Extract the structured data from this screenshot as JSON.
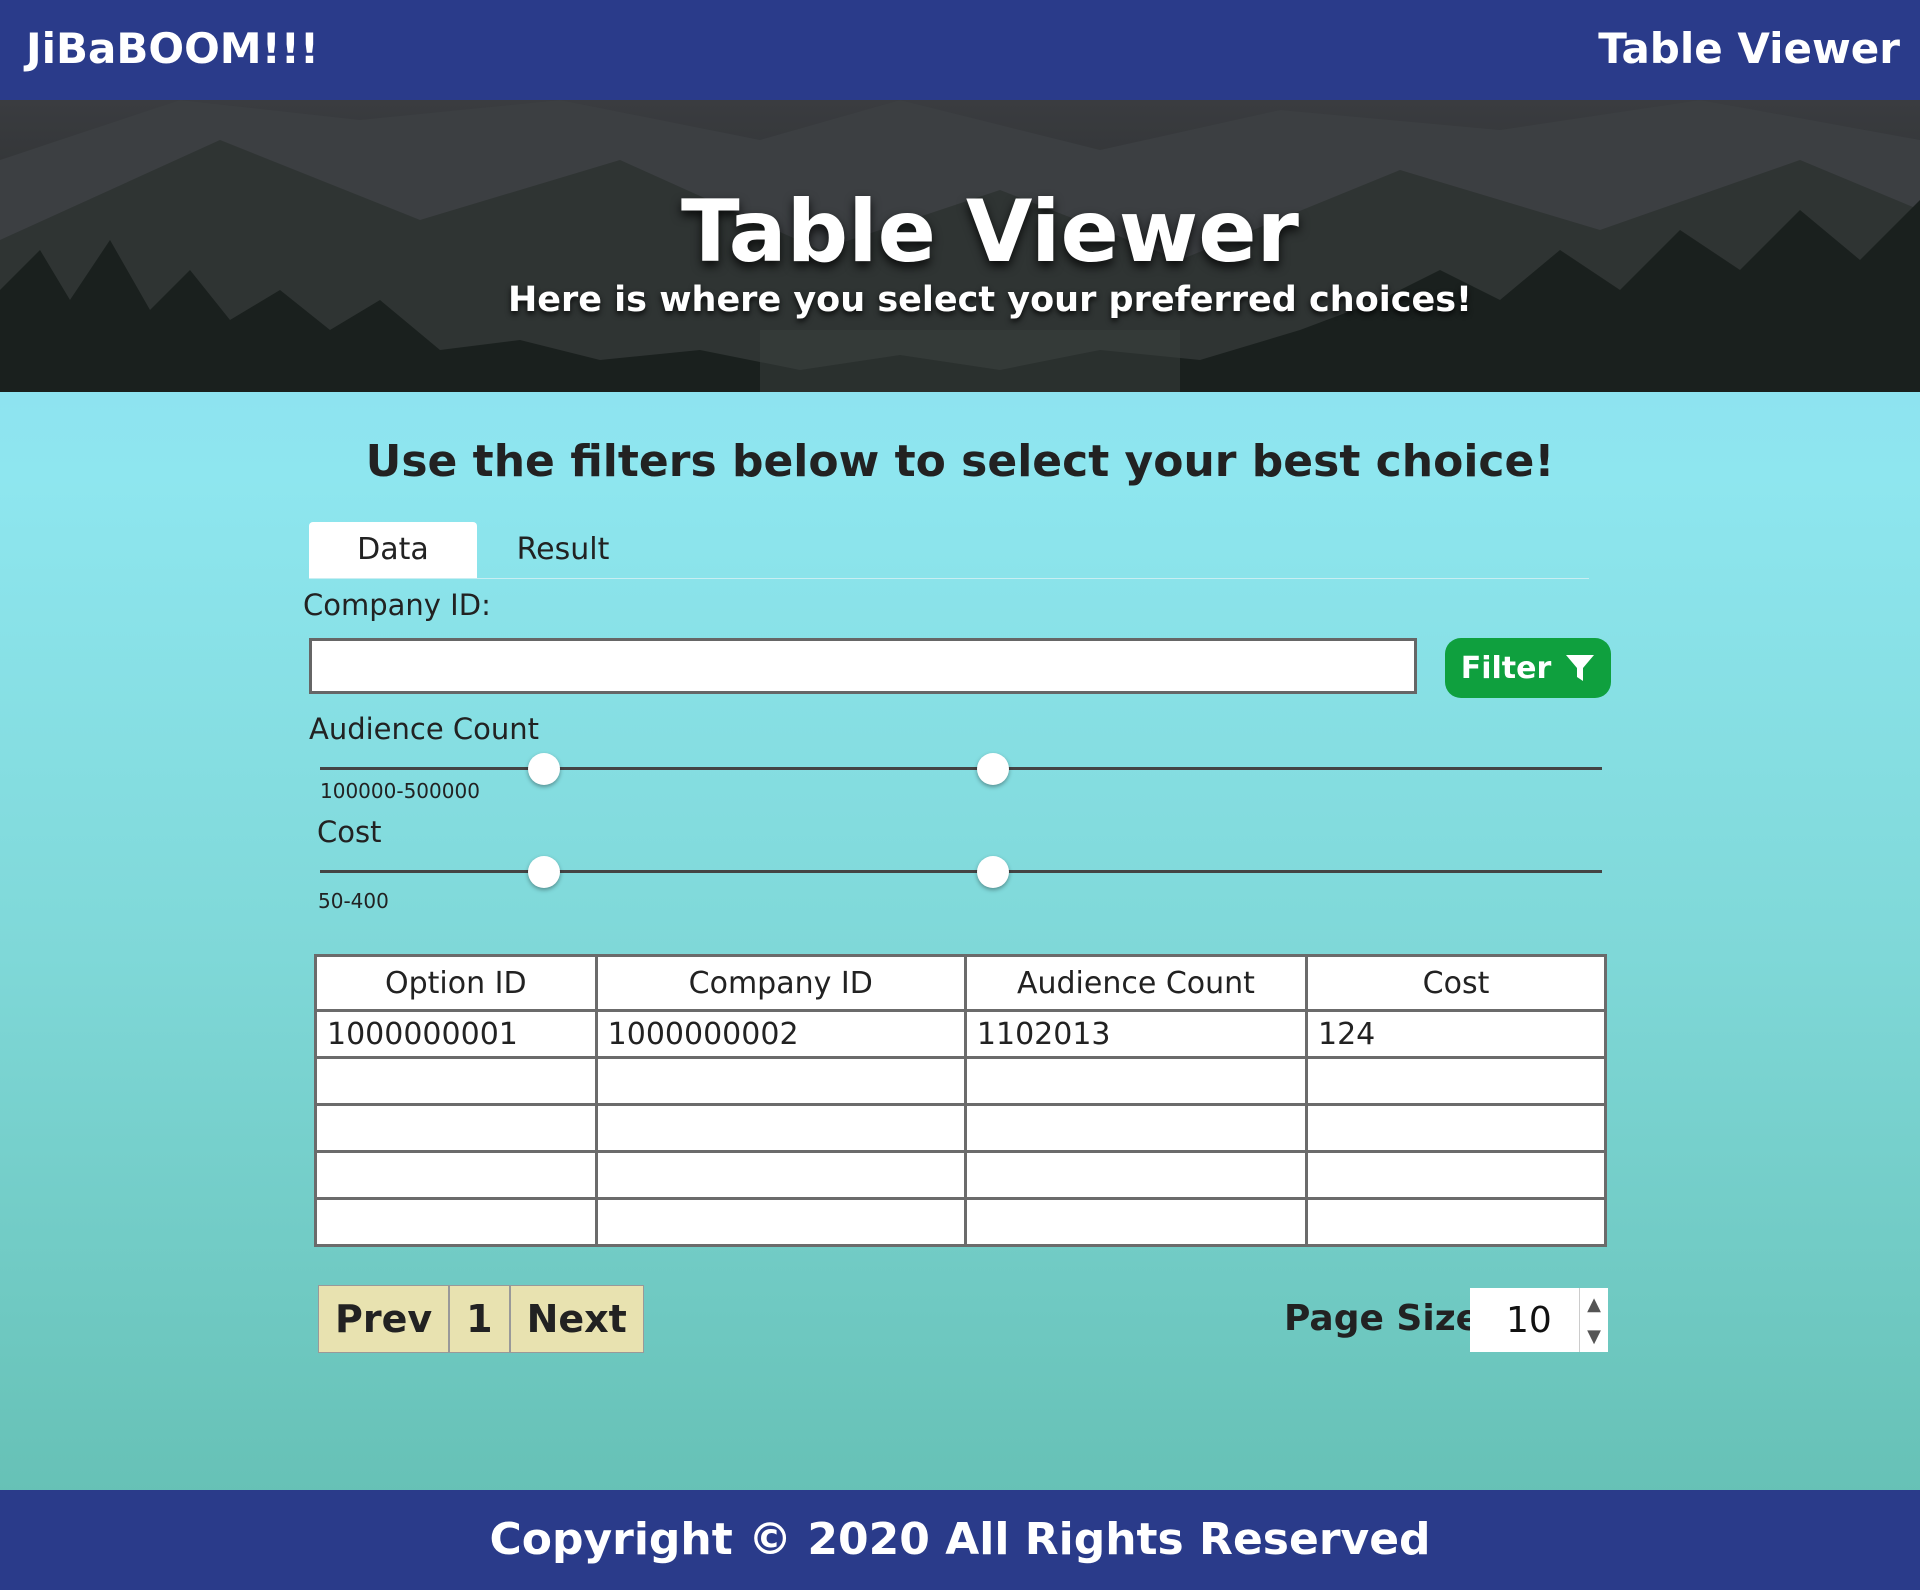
{
  "topbar": {
    "brand": "JiBaBOOM!!!",
    "title": "Table Viewer"
  },
  "hero": {
    "title": "Table Viewer",
    "subtitle": "Here is where you select your preferred choices!"
  },
  "main": {
    "heading": "Use the filters below to select your best choice!",
    "tabs": [
      {
        "label": "Data",
        "active": true
      },
      {
        "label": "Result",
        "active": false
      }
    ],
    "company_label": "Company ID:",
    "company_value": "",
    "filter_button": "Filter",
    "filter_icon": "funnel-icon",
    "sliders": [
      {
        "label": "Audience Count",
        "range_text": "100000-500000",
        "low_fraction": 0.175,
        "high_fraction": 0.525
      },
      {
        "label": "Cost",
        "range_text": "50-400",
        "low_fraction": 0.175,
        "high_fraction": 0.525
      }
    ]
  },
  "table": {
    "columns": [
      "Option ID",
      "Company ID",
      "Audience Count",
      "Cost"
    ],
    "rows": [
      [
        "1000000001",
        "1000000002",
        "1102013",
        "124"
      ],
      [
        "",
        "",
        "",
        ""
      ],
      [
        "",
        "",
        "",
        ""
      ],
      [
        "",
        "",
        "",
        ""
      ],
      [
        "",
        "",
        "",
        ""
      ]
    ]
  },
  "pagination": {
    "prev": "Prev",
    "page": "1",
    "next": "Next",
    "page_size_label": "Page Size:",
    "page_size": "10"
  },
  "footer": {
    "text": "Copyright © 2020 All Rights Reserved"
  },
  "colors": {
    "bar": "#2a3b8a",
    "filter": "#0fa03e",
    "pager": "#e8e2b0"
  }
}
